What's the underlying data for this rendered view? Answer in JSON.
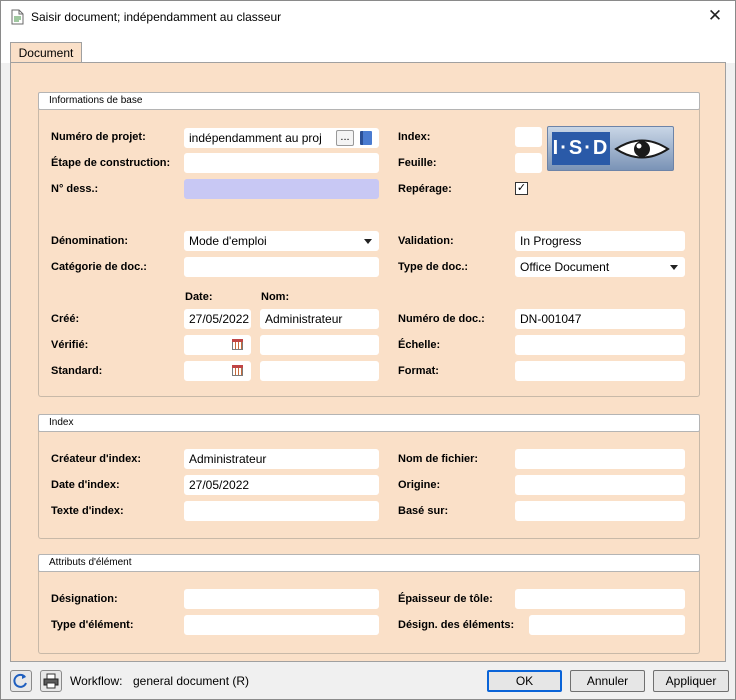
{
  "window": {
    "title": "Saisir document; indépendamment au classeur",
    "close_glyph": "✕"
  },
  "tabs": [
    {
      "label": "Document"
    }
  ],
  "basic": {
    "header": "Informations de base",
    "project_label": "Numéro de projet:",
    "project_value": "indépendamment au proj",
    "project_ellipsis": "...",
    "stage_label": "Étape de construction:",
    "stage_value": "",
    "drawing_no_label": "N° dess.:",
    "drawing_no_value": "",
    "index_label": "Index:",
    "index_value": "",
    "sheet_label": "Feuille:",
    "sheet_value": "",
    "marking_label": "Repérage:",
    "marking_checked": "✓",
    "designation_label": "Dénomination:",
    "designation_value": "Mode d'emploi",
    "validation_label": "Validation:",
    "validation_value": "In Progress",
    "doc_category_label": "Catégorie de doc.:",
    "doc_category_value": "",
    "doc_type_label": "Type de doc.:",
    "doc_type_value": "Office Document",
    "date_header": "Date:",
    "name_header": "Nom:",
    "created_label": "Créé:",
    "created_date": "27/05/2022",
    "created_name": "Administrateur",
    "doc_number_label": "Numéro de doc.:",
    "doc_number_value": "DN-001047",
    "checked_label": "Vérifié:",
    "checked_date": "",
    "checked_name": "",
    "scale_label": "Échelle:",
    "scale_value": "",
    "standard_label": "Standard:",
    "standard_date": "",
    "standard_name": "",
    "format_label": "Format:",
    "format_value": "",
    "logo_text": "I·S·D"
  },
  "index": {
    "header": "Index",
    "creator_label": "Créateur d'index:",
    "creator_value": "Administrateur",
    "date_label": "Date d'index:",
    "date_value": "27/05/2022",
    "text_label": "Texte d'index:",
    "text_value": "",
    "filename_label": "Nom de fichier:",
    "filename_value": "",
    "origin_label": "Origine:",
    "origin_value": "",
    "based_on_label": "Basé sur:",
    "based_on_value": ""
  },
  "element": {
    "header": "Attributs d'élément",
    "designation_label": "Désignation:",
    "designation_value": "",
    "type_label": "Type d'élément:",
    "type_value": "",
    "thickness_label": "Épaisseur de tôle:",
    "thickness_value": "",
    "element_names_label": "Désign. des éléments:",
    "element_names_value": ""
  },
  "footer": {
    "refresh_icon": "refresh-icon",
    "print_icon": "print-icon",
    "workflow_label": "Workflow:",
    "workflow_value": "general document (R)",
    "ok_label": "OK",
    "cancel_label": "Annuler",
    "apply_label": "Appliquer"
  },
  "colors": {
    "panel": "#fae0c8",
    "highlight_field": "#c8c8f4",
    "default_button_border": "#0a64d8"
  }
}
